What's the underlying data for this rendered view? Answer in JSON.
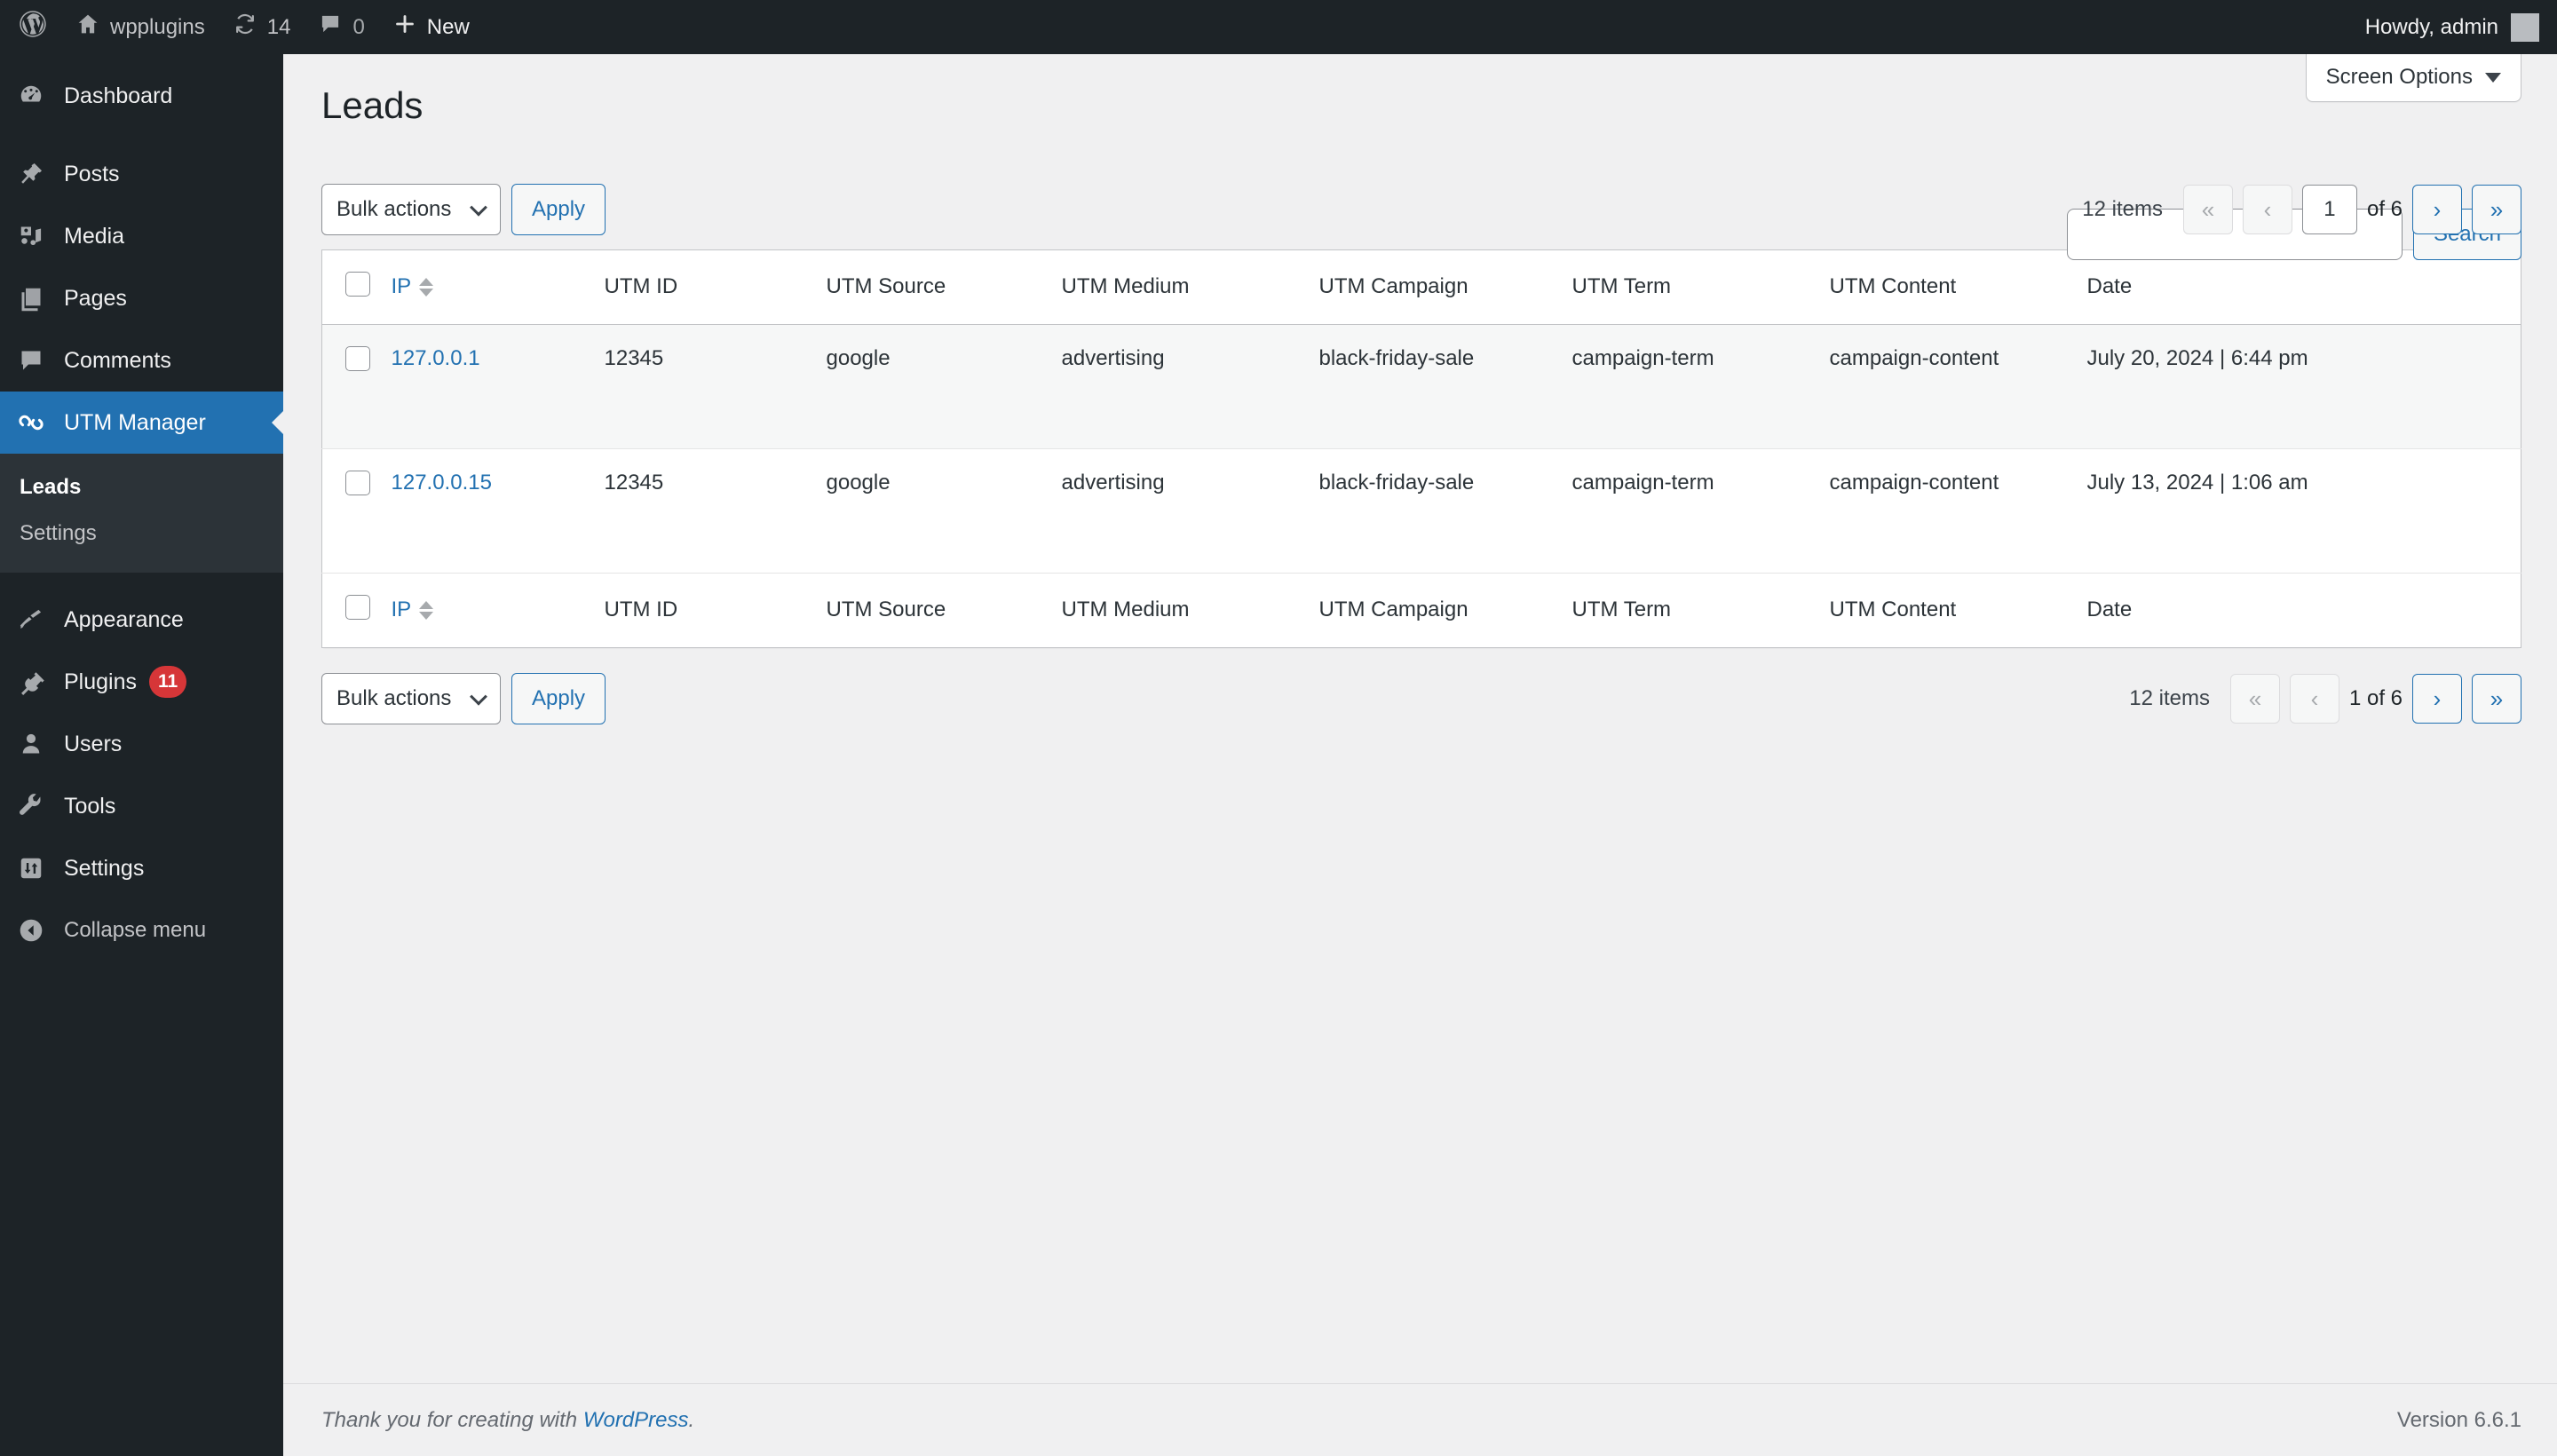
{
  "adminbar": {
    "wp_logo": "wordpress-logo-icon",
    "site_name": "wpplugins",
    "updates_icon": "updates-icon",
    "updates_count": "14",
    "comments_icon": "comments-icon",
    "comments_count": "0",
    "new_icon": "plus-icon",
    "new_label": "New",
    "howdy": "Howdy, admin",
    "avatar": "user-avatar"
  },
  "sidebar": {
    "items": [
      {
        "label": "Dashboard",
        "icon": "dashboard-icon",
        "current": false
      },
      {
        "label": "Posts",
        "icon": "pin-icon",
        "current": false
      },
      {
        "label": "Media",
        "icon": "media-icon",
        "current": false
      },
      {
        "label": "Pages",
        "icon": "pages-icon",
        "current": false
      },
      {
        "label": "Comments",
        "icon": "comment-icon",
        "current": false
      },
      {
        "label": "UTM Manager",
        "icon": "link-icon",
        "current": true
      }
    ],
    "submenu": [
      {
        "label": "Leads",
        "current": true
      },
      {
        "label": "Settings",
        "current": false
      }
    ],
    "items_lower": [
      {
        "label": "Appearance",
        "icon": "brush-icon",
        "badge": ""
      },
      {
        "label": "Plugins",
        "icon": "plug-icon",
        "badge": "11"
      },
      {
        "label": "Users",
        "icon": "user-icon",
        "badge": ""
      },
      {
        "label": "Tools",
        "icon": "wrench-icon",
        "badge": ""
      },
      {
        "label": "Settings",
        "icon": "settings-icon",
        "badge": ""
      }
    ],
    "collapse": {
      "label": "Collapse menu",
      "icon": "collapse-arrow-icon"
    }
  },
  "screen_options": {
    "label": "Screen Options",
    "caret": "chevron-down-icon"
  },
  "page": {
    "title": "Leads"
  },
  "search": {
    "value": "",
    "placeholder": "",
    "button_label": "Search"
  },
  "tablenav_top": {
    "bulk_actions_label": "Bulk actions",
    "apply_label": "Apply",
    "displaying_num": "12 items",
    "first_page": "«",
    "prev_page": "‹",
    "current_page": "1",
    "of_label": "of 6",
    "next_page": "›",
    "last_page": "»"
  },
  "tablenav_bottom": {
    "bulk_actions_label": "Bulk actions",
    "apply_label": "Apply",
    "displaying_num": "12 items",
    "first_page": "«",
    "prev_page": "‹",
    "paging_text": "1 of 6",
    "next_page": "›",
    "last_page": "»"
  },
  "table": {
    "columns": [
      {
        "label": "IP",
        "sortable": true
      },
      {
        "label": "UTM ID",
        "sortable": false
      },
      {
        "label": "UTM Source",
        "sortable": false
      },
      {
        "label": "UTM Medium",
        "sortable": false
      },
      {
        "label": "UTM Campaign",
        "sortable": false
      },
      {
        "label": "UTM Term",
        "sortable": false
      },
      {
        "label": "UTM Content",
        "sortable": false
      },
      {
        "label": "Date",
        "sortable": false
      }
    ],
    "rows": [
      {
        "ip": "127.0.0.1",
        "utm_id": "12345",
        "utm_source": "google",
        "utm_medium": "advertising",
        "utm_campaign": "black-friday-sale",
        "utm_term": "campaign-term",
        "utm_content": "campaign-content",
        "date": "July 20, 2024 | 6:44 pm"
      },
      {
        "ip": "127.0.0.15",
        "utm_id": "12345",
        "utm_source": "google",
        "utm_medium": "advertising",
        "utm_campaign": "black-friday-sale",
        "utm_term": "campaign-term",
        "utm_content": "campaign-content",
        "date": "July 13, 2024 | 1:06 am"
      }
    ]
  },
  "footer": {
    "thanks_prefix": "Thank you for creating with ",
    "wordpress_link": "WordPress",
    "thanks_suffix": ".",
    "version": "Version 6.6.1"
  },
  "colors": {
    "accent": "#2271b1",
    "sidebar_bg": "#1d2327",
    "submenu_bg": "#2c3338",
    "badge": "#d63638",
    "content_bg": "#f0f0f1"
  }
}
